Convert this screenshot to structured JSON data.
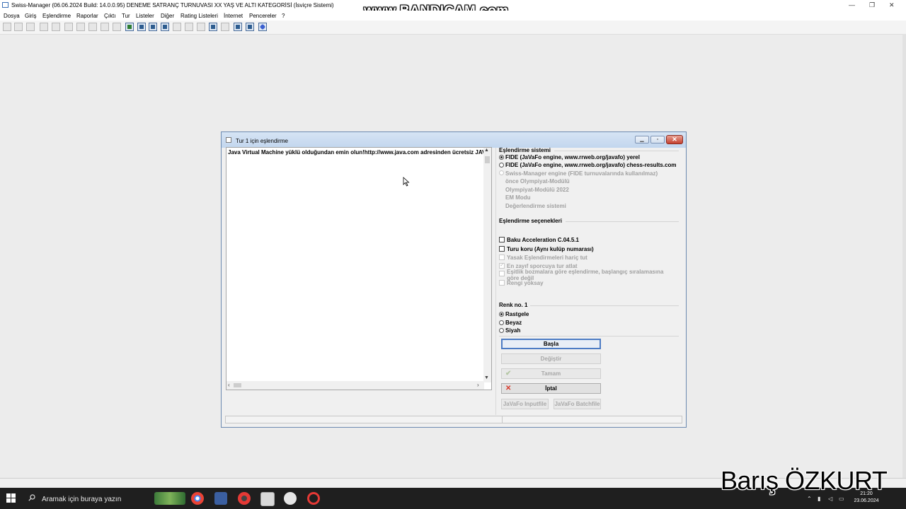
{
  "app": {
    "title": "Swiss-Manager (06.06.2024 Build: 14.0.0.95)  DENEME SATRANÇ TURNUVASI  XX YAŞ VE ALTI KATEGORİSİ  (İsviçre Sistemi)",
    "watermark": "www.BANDICAM.com",
    "window_controls": [
      "—",
      "❐",
      "✕"
    ]
  },
  "menu": [
    "Dosya",
    "Giriş",
    "Eşlendirme",
    "Raporlar",
    "Çıktı",
    "Tur",
    "Listeler",
    "Diğer",
    "Rating Listeleri",
    "İnternet",
    "Pencereler",
    "?"
  ],
  "dialog": {
    "title": "Tur 1 için eşlendirme",
    "log_text": "Java Virtual Machine yüklü olduğundan emin olun!http://www.java.com adresinden ücretsiz JAVA",
    "pairing_system": {
      "label": "Eşlendirme sistemi",
      "options": [
        {
          "label": "FIDE (JaVaFo engine, www.rrweb.org/javafo) yerel",
          "selected": true,
          "enabled": true
        },
        {
          "label": "FIDE (JaVaFo engine, www.rrweb.org/javafo) chess-results.com",
          "selected": false,
          "enabled": true
        },
        {
          "label": "Swiss-Manager engine (FIDE turnuvalarında kullanılmaz)",
          "selected": false,
          "enabled": false
        },
        {
          "label": "önce Olympiyat-Modülü",
          "selected": false,
          "enabled": false
        },
        {
          "label": "Olympiyat-Modülü 2022",
          "selected": false,
          "enabled": false
        },
        {
          "label": "EM Modu",
          "selected": false,
          "enabled": false
        },
        {
          "label": "Değerlendirme sistemi",
          "selected": false,
          "enabled": false
        }
      ]
    },
    "pairing_options": {
      "label": "Eşlendirme seçenekleri",
      "options": [
        {
          "label": "Baku Acceleration C.04.5.1",
          "checked": false,
          "enabled": true
        },
        {
          "label": "Turu koru (Aynı kulüp numarası)",
          "checked": false,
          "enabled": true
        },
        {
          "label": "Yasak Eşlendirmeleri hariç tut",
          "checked": false,
          "enabled": false
        },
        {
          "label": "En zayıf sporcuya tur atlat",
          "checked": true,
          "enabled": false
        },
        {
          "label": "Eşitlik bozmalara göre eşlendirme, başlangıç sıralamasına göre değil",
          "checked": false,
          "enabled": false
        },
        {
          "label": "Rengi yoksay",
          "checked": false,
          "enabled": false
        }
      ]
    },
    "color": {
      "label": "Renk no. 1",
      "options": [
        {
          "label": "Rastgele",
          "selected": true
        },
        {
          "label": "Beyaz",
          "selected": false
        },
        {
          "label": "Siyah",
          "selected": false
        }
      ]
    },
    "buttons": {
      "start": "Başla",
      "change": "Değiştir",
      "ok": "Tamam",
      "cancel": "İptal",
      "javafo_input": "JaVaFo Inputfile",
      "javafo_batch": "JaVaFo Batchfile"
    }
  },
  "taskbar": {
    "search_placeholder": "Aramak için buraya yazın",
    "time": "21:20",
    "date": "23.06.2024"
  },
  "overlay_name": "Barış ÖZKURT"
}
